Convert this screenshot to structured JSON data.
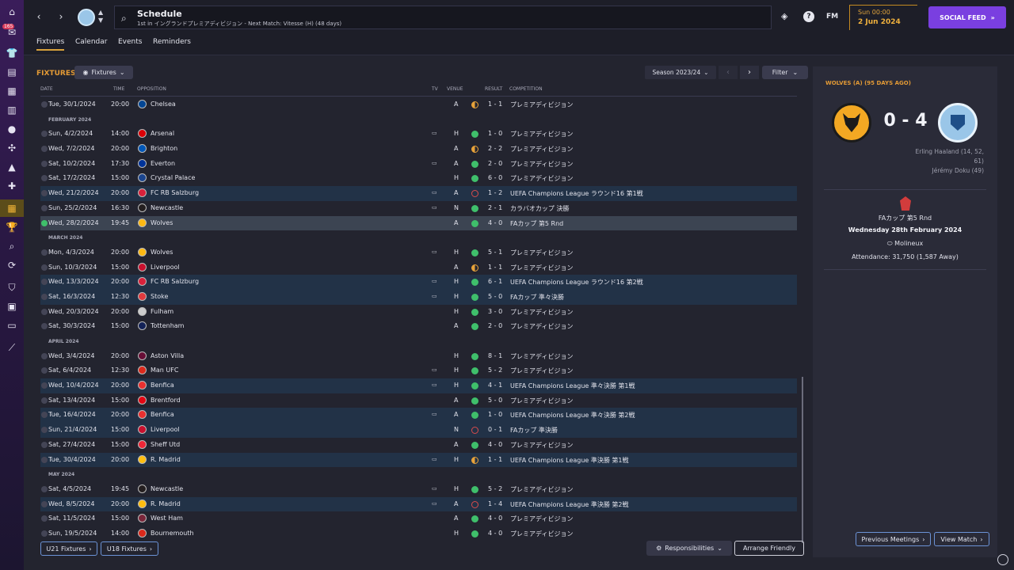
{
  "rail": {
    "badge": "165",
    "icons": [
      "home-icon",
      "inbox-icon",
      "squad-icon",
      "tactics-icon",
      "data-icon",
      "scouting-icon",
      "dev-centre-icon",
      "club-vision-icon",
      "staff-icon",
      "training-icon",
      "medical-icon",
      "schedule-icon",
      "competitions-icon",
      "search-icon",
      "transfers-icon",
      "club-info-icon",
      "finances-icon",
      "tickets-icon",
      "settings-icon"
    ]
  },
  "header": {
    "back": "‹",
    "forward": "›",
    "title": "Schedule",
    "subtitle": "1st in イングランドプレミアディビジョン - Next Match: Vitesse (H) (48 days)",
    "help": "?",
    "fm": "FM",
    "time": "Sun 00:00",
    "date": "2 Jun 2024",
    "social_feed": "SOCIAL FEED"
  },
  "tabs": [
    "Fixtures",
    "Calendar",
    "Events",
    "Reminders"
  ],
  "toolbar": {
    "title": "FIXTURES",
    "view_dropdown": "Fixtures",
    "season": "Season 2023/24",
    "filter": "Filter"
  },
  "columns": {
    "date": "DATE",
    "time": "TIME",
    "opposition": "OPPOSITION",
    "tv": "TV",
    "venue": "VENUE",
    "result": "RESULT",
    "competition": "COMPETITION"
  },
  "fixtures": [
    {
      "type": "match",
      "date": "Tue, 30/1/2024",
      "time": "20:00",
      "opp": "Chelsea",
      "crest": "#034694",
      "tv": false,
      "venue": "A",
      "res": "draw",
      "score": "1 - 1",
      "comp": "プレミアディビジョン",
      "ucl": false
    },
    {
      "type": "month",
      "label": "FEBRUARY 2024"
    },
    {
      "type": "match",
      "date": "Sun, 4/2/2024",
      "time": "14:00",
      "opp": "Arsenal",
      "crest": "#db0007",
      "tv": true,
      "venue": "H",
      "res": "win",
      "score": "1 - 0",
      "comp": "プレミアディビジョン",
      "ucl": false
    },
    {
      "type": "match",
      "date": "Wed, 7/2/2024",
      "time": "20:00",
      "opp": "Brighton",
      "crest": "#0057b8",
      "tv": false,
      "venue": "A",
      "res": "draw",
      "score": "2 - 2",
      "comp": "プレミアディビジョン",
      "ucl": false
    },
    {
      "type": "match",
      "date": "Sat, 10/2/2024",
      "time": "17:30",
      "opp": "Everton",
      "crest": "#003399",
      "tv": true,
      "venue": "A",
      "res": "win",
      "score": "2 - 0",
      "comp": "プレミアディビジョン",
      "ucl": false
    },
    {
      "type": "match",
      "date": "Sat, 17/2/2024",
      "time": "15:00",
      "opp": "Crystal Palace",
      "crest": "#1b458f",
      "tv": false,
      "venue": "H",
      "res": "win",
      "score": "6 - 0",
      "comp": "プレミアディビジョン",
      "ucl": false
    },
    {
      "type": "match",
      "date": "Wed, 21/2/2024",
      "time": "20:00",
      "opp": "FC RB Salzburg",
      "crest": "#d8213b",
      "tv": true,
      "venue": "A",
      "res": "loss",
      "score": "1 - 2",
      "comp": "UEFA Champions League ラウンド16 第1戦",
      "ucl": true
    },
    {
      "type": "match",
      "date": "Sun, 25/2/2024",
      "time": "16:30",
      "opp": "Newcastle",
      "crest": "#241f20",
      "tv": true,
      "venue": "N",
      "res": "win",
      "score": "2 - 1",
      "comp": "カラバオカップ 決勝",
      "ucl": false
    },
    {
      "type": "match",
      "date": "Wed, 28/2/2024",
      "time": "19:45",
      "opp": "Wolves",
      "crest": "#fdb913",
      "tv": false,
      "venue": "A",
      "res": "win",
      "score": "4 - 0",
      "comp": "FAカップ 第5 Rnd",
      "ucl": false,
      "selected": true
    },
    {
      "type": "month",
      "label": "MARCH 2024"
    },
    {
      "type": "match",
      "date": "Mon, 4/3/2024",
      "time": "20:00",
      "opp": "Wolves",
      "crest": "#fdb913",
      "tv": true,
      "venue": "H",
      "res": "win",
      "score": "5 - 1",
      "comp": "プレミアディビジョン",
      "ucl": false
    },
    {
      "type": "match",
      "date": "Sun, 10/3/2024",
      "time": "15:00",
      "opp": "Liverpool",
      "crest": "#c8102e",
      "tv": false,
      "venue": "A",
      "res": "draw",
      "score": "1 - 1",
      "comp": "プレミアディビジョン",
      "ucl": false
    },
    {
      "type": "match",
      "date": "Wed, 13/3/2024",
      "time": "20:00",
      "opp": "FC RB Salzburg",
      "crest": "#d8213b",
      "tv": true,
      "venue": "H",
      "res": "win",
      "score": "6 - 1",
      "comp": "UEFA Champions League ラウンド16 第2戦",
      "ucl": true
    },
    {
      "type": "match",
      "date": "Sat, 16/3/2024",
      "time": "12:30",
      "opp": "Stoke",
      "crest": "#e03a3e",
      "tv": true,
      "venue": "H",
      "res": "win",
      "score": "5 - 0",
      "comp": "FAカップ 準々決勝",
      "ucl": true
    },
    {
      "type": "match",
      "date": "Wed, 20/3/2024",
      "time": "20:00",
      "opp": "Fulham",
      "crest": "#cccccc",
      "tv": false,
      "venue": "H",
      "res": "win",
      "score": "3 - 0",
      "comp": "プレミアディビジョン",
      "ucl": false
    },
    {
      "type": "match",
      "date": "Sat, 30/3/2024",
      "time": "15:00",
      "opp": "Tottenham",
      "crest": "#132257",
      "tv": false,
      "venue": "A",
      "res": "win",
      "score": "2 - 0",
      "comp": "プレミアディビジョン",
      "ucl": false
    },
    {
      "type": "month",
      "label": "APRIL 2024"
    },
    {
      "type": "match",
      "date": "Wed, 3/4/2024",
      "time": "20:00",
      "opp": "Aston Villa",
      "crest": "#670e36",
      "tv": false,
      "venue": "H",
      "res": "win",
      "score": "8 - 1",
      "comp": "プレミアディビジョン",
      "ucl": false
    },
    {
      "type": "match",
      "date": "Sat, 6/4/2024",
      "time": "12:30",
      "opp": "Man UFC",
      "crest": "#da291c",
      "tv": true,
      "venue": "H",
      "res": "win",
      "score": "5 - 2",
      "comp": "プレミアディビジョン",
      "ucl": false
    },
    {
      "type": "match",
      "date": "Wed, 10/4/2024",
      "time": "20:00",
      "opp": "Benfica",
      "crest": "#e83030",
      "tv": true,
      "venue": "H",
      "res": "win",
      "score": "4 - 1",
      "comp": "UEFA Champions League 準々決勝 第1戦",
      "ucl": true
    },
    {
      "type": "match",
      "date": "Sat, 13/4/2024",
      "time": "15:00",
      "opp": "Brentford",
      "crest": "#e30613",
      "tv": false,
      "venue": "A",
      "res": "win",
      "score": "5 - 0",
      "comp": "プレミアディビジョン",
      "ucl": false
    },
    {
      "type": "match",
      "date": "Tue, 16/4/2024",
      "time": "20:00",
      "opp": "Benfica",
      "crest": "#e83030",
      "tv": true,
      "venue": "A",
      "res": "win",
      "score": "1 - 0",
      "comp": "UEFA Champions League 準々決勝 第2戦",
      "ucl": true
    },
    {
      "type": "match",
      "date": "Sun, 21/4/2024",
      "time": "15:00",
      "opp": "Liverpool",
      "crest": "#c8102e",
      "tv": false,
      "venue": "N",
      "res": "loss",
      "score": "0 - 1",
      "comp": "FAカップ 準決勝",
      "ucl": true
    },
    {
      "type": "match",
      "date": "Sat, 27/4/2024",
      "time": "15:00",
      "opp": "Sheff Utd",
      "crest": "#ee2737",
      "tv": false,
      "venue": "A",
      "res": "win",
      "score": "4 - 0",
      "comp": "プレミアディビジョン",
      "ucl": false
    },
    {
      "type": "match",
      "date": "Tue, 30/4/2024",
      "time": "20:00",
      "opp": "R. Madrid",
      "crest": "#febe10",
      "tv": true,
      "venue": "H",
      "res": "draw",
      "score": "1 - 1",
      "comp": "UEFA Champions League 準決勝 第1戦",
      "ucl": true
    },
    {
      "type": "month",
      "label": "MAY 2024"
    },
    {
      "type": "match",
      "date": "Sat, 4/5/2024",
      "time": "19:45",
      "opp": "Newcastle",
      "crest": "#241f20",
      "tv": true,
      "venue": "H",
      "res": "win",
      "score": "5 - 2",
      "comp": "プレミアディビジョン",
      "ucl": false
    },
    {
      "type": "match",
      "date": "Wed, 8/5/2024",
      "time": "20:00",
      "opp": "R. Madrid",
      "crest": "#febe10",
      "tv": true,
      "venue": "A",
      "res": "loss",
      "score": "1 - 4",
      "comp": "UEFA Champions League 準決勝 第2戦",
      "ucl": true
    },
    {
      "type": "match",
      "date": "Sat, 11/5/2024",
      "time": "15:00",
      "opp": "West Ham",
      "crest": "#7a263a",
      "tv": false,
      "venue": "A",
      "res": "win",
      "score": "4 - 0",
      "comp": "プレミアディビジョン",
      "ucl": false
    },
    {
      "type": "match",
      "date": "Sun, 19/5/2024",
      "time": "14:00",
      "opp": "Bournemouth",
      "crest": "#da291c",
      "tv": false,
      "venue": "H",
      "res": "win",
      "score": "4 - 0",
      "comp": "プレミアディビジョン",
      "ucl": false
    }
  ],
  "result_colors": {
    "win": "#3fbf6b",
    "draw": "#e7a23a",
    "loss": "#d84c4c"
  },
  "bottom": {
    "u21": "U21 Fixtures",
    "u18": "U18 Fixtures",
    "responsibilities": "Responsibilities",
    "arrange": "Arrange Friendly"
  },
  "match_panel": {
    "title": "WOLVES (A) (95 DAYS AGO)",
    "score": "0 - 4",
    "scorers": [
      "Erling Haaland (14, 52,",
      "61)",
      "Jérémy Doku (49)"
    ],
    "competition": "FAカップ 第5 Rnd",
    "date": "Wednesday 28th February 2024",
    "venue": "Molineux",
    "attendance": "Attendance: 31,750 (1,587 Away)",
    "previous_meetings": "Previous Meetings",
    "view_match": "View Match"
  }
}
